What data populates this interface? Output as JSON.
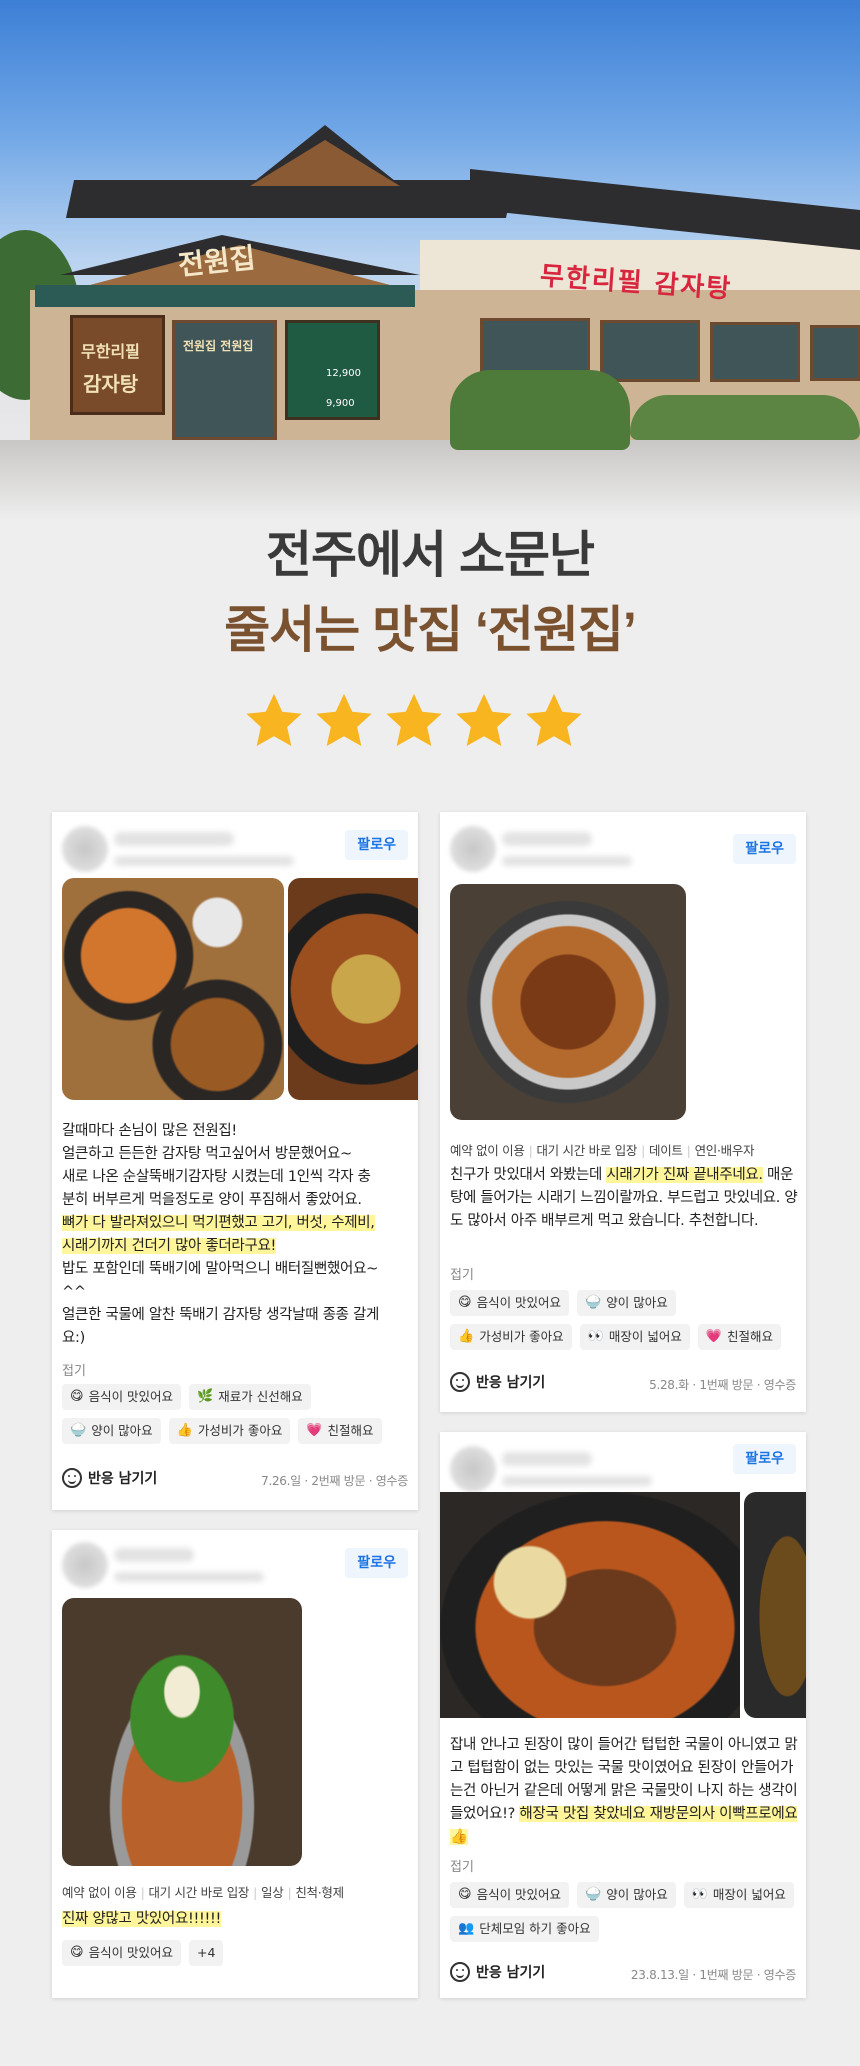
{
  "hero": {
    "sign_main": "전원집",
    "sign_right": "무한리필 감자탕",
    "sign_left_1": "무한리필",
    "sign_left_2": "감자탕",
    "sign_door": "전원집 전원집",
    "menu_price_1": "12,900",
    "menu_price_2": "9,900"
  },
  "headline": {
    "line1": "전주에서 소문난",
    "line2": "줄서는 맛집 ‘전원집’"
  },
  "colors": {
    "line1": "#3a3a3a",
    "line2": "#7a5230",
    "star": "#f9b51f",
    "highlight": "#fff59a",
    "follow": "#1b74e4"
  },
  "rating_stars": 5,
  "reviews": [
    {
      "follow_label": "팔로우",
      "text_lines": [
        {
          "t": "갈때마다 손님이 많은 전원집!",
          "hl": false
        },
        {
          "t": "얼큰하고 든든한 감자탕 먹고싶어서 방문했어요~",
          "hl": false
        },
        {
          "t": "새로 나온 순살뚝배기감자탕 시켰는데 1인씩 각자 충",
          "hl": false
        },
        {
          "t": "분히 버부르게 먹을정도로 양이 푸짐해서 좋았어요.",
          "hl": false
        },
        {
          "t": "뼈가 다 발라져있으니 먹기편했고 고기, 버섯, 수제비,",
          "hl": true
        },
        {
          "t": "시래기까지 건더기 많아 좋더라구요!",
          "hl": true
        },
        {
          "t": "밥도 포함인데 뚝배기에 말아먹으니 배터질뻔했어요~",
          "hl": false
        },
        {
          "t": "^^",
          "hl": false
        },
        {
          "t": "얼큰한 국물에 알찬 뚝배기 감자탕 생각날때 종종 갈게",
          "hl": false
        },
        {
          "t": "요:)",
          "hl": false
        }
      ],
      "fold_label": "접기",
      "chips": [
        {
          "icon": "😋",
          "label": "음식이 맛있어요"
        },
        {
          "icon": "🌿",
          "label": "재료가 신선해요"
        },
        {
          "icon": "🍚",
          "label": "양이 많아요"
        },
        {
          "icon": "👍",
          "label": "가성비가 좋아요"
        },
        {
          "icon": "💗",
          "label": "친절해요"
        }
      ],
      "react_label": "반응 남기기",
      "meta": "7.26.일 · 2번째 방문 · 영수증"
    },
    {
      "follow_label": "팔로우",
      "tags": [
        "예약 없이 이용",
        "대기 시간 바로 입장",
        "데이트",
        "연인·배우자"
      ],
      "text_before": "친구가 맛있대서 와봤는데 ",
      "text_hl": "시래기가 진짜 끝내주네요.",
      "text_after": " 매운탕에 들어가는 시래기 느낌이랄까요. 부드럽고 맛있네요. 양도 많아서 아주 배부르게 먹고 왔습니다. 추천합니다.",
      "fold_label": "접기",
      "chips": [
        {
          "icon": "😋",
          "label": "음식이 맛있어요"
        },
        {
          "icon": "🍚",
          "label": "양이 많아요"
        },
        {
          "icon": "👍",
          "label": "가성비가 좋아요"
        },
        {
          "icon": "👀",
          "label": "매장이 넓어요"
        },
        {
          "icon": "💗",
          "label": "친절해요"
        }
      ],
      "react_label": "반응 남기기",
      "meta": "5.28.화 · 1번째 방문 · 영수증"
    },
    {
      "follow_label": "팔로우",
      "tags": [
        "예약 없이 이용",
        "대기 시간 바로 입장",
        "일상",
        "친척·형제"
      ],
      "text_hl": "진짜 양많고 맛있어요!!!!!!",
      "chips": [
        {
          "icon": "😋",
          "label": "음식이 맛있어요"
        }
      ],
      "more_label": "+4"
    },
    {
      "follow_label": "팔로우",
      "text_before": "잡내 안나고 된장이 많이 들어간 텁텁한 국물이 아니였고 맑고 텁텁함이 없는 맛있는 국물 맛이였어요 된장이 안들어가는건 아닌거 같은데 어떻게 맑은 국물맛이 나지 하는 생각이 들었어요!? ",
      "text_hl": "해장국 맛집 찾았네요 재방문의사 이빡프로에요👍",
      "fold_label": "접기",
      "chips": [
        {
          "icon": "😋",
          "label": "음식이 맛있어요"
        },
        {
          "icon": "🍚",
          "label": "양이 많아요"
        },
        {
          "icon": "👀",
          "label": "매장이 넓어요"
        },
        {
          "icon": "👥",
          "label": "단체모임 하기 좋아요"
        }
      ],
      "react_label": "반응 남기기",
      "meta": "23.8.13.일 · 1번째 방문 · 영수증"
    }
  ]
}
